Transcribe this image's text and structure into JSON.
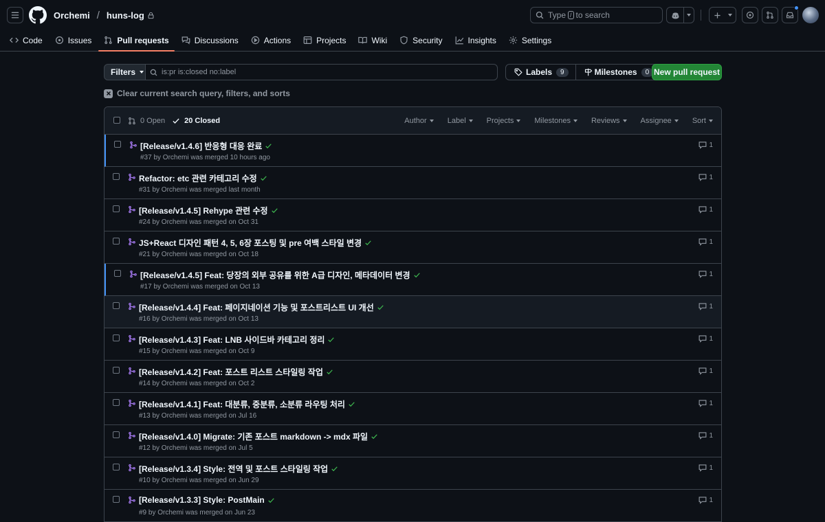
{
  "header": {
    "owner": "Orchemi",
    "separator": "/",
    "repo": "huns-log",
    "search_prefix": "Type",
    "search_key": "/",
    "search_suffix": "to search"
  },
  "repo_nav": [
    {
      "label": "Code",
      "icon": "code-icon",
      "active": false
    },
    {
      "label": "Issues",
      "icon": "issue-icon",
      "active": false
    },
    {
      "label": "Pull requests",
      "icon": "pull-request-icon",
      "active": true
    },
    {
      "label": "Discussions",
      "icon": "discussion-icon",
      "active": false
    },
    {
      "label": "Actions",
      "icon": "play-icon",
      "active": false
    },
    {
      "label": "Projects",
      "icon": "table-icon",
      "active": false
    },
    {
      "label": "Wiki",
      "icon": "book-icon",
      "active": false
    },
    {
      "label": "Security",
      "icon": "shield-icon",
      "active": false
    },
    {
      "label": "Insights",
      "icon": "graph-icon",
      "active": false
    },
    {
      "label": "Settings",
      "icon": "gear-icon",
      "active": false
    }
  ],
  "toolbar": {
    "filters_label": "Filters",
    "query": "is:pr is:closed no:label",
    "labels_label": "Labels",
    "labels_count": "9",
    "milestones_label": "Milestones",
    "milestones_count": "0",
    "new_pr_label": "New pull request",
    "clear_label": "Clear current search query, filters, and sorts"
  },
  "list_header": {
    "open_label": "0 Open",
    "closed_label": "20 Closed",
    "filters": [
      "Author",
      "Label",
      "Projects",
      "Milestones",
      "Reviews",
      "Assignee",
      "Sort"
    ]
  },
  "pull_requests": [
    {
      "title": "[Release/v1.4.6] 반응형 대응 완료",
      "meta": "#37 by Orchemi was merged 10 hours ago",
      "comments": "1",
      "unread": true,
      "hover": false
    },
    {
      "title": "Refactor: etc 관련 카테고리 수정",
      "meta": "#31 by Orchemi was merged last month",
      "comments": "1",
      "unread": false,
      "hover": false
    },
    {
      "title": "[Release/v1.4.5] Rehype 관련 수정",
      "meta": "#24 by Orchemi was merged on Oct 31",
      "comments": "1",
      "unread": false,
      "hover": false
    },
    {
      "title": "JS+React 디자인 패턴 4, 5, 6장 포스팅 및 pre 여백 스타일 변경",
      "meta": "#21 by Orchemi was merged on Oct 18",
      "comments": "1",
      "unread": false,
      "hover": false
    },
    {
      "title": "[Release/v1.4.5] Feat: 당장의 외부 공유를 위한 A급 디자인, 메타데이터 변경",
      "meta": "#17 by Orchemi was merged on Oct 13",
      "comments": "1",
      "unread": true,
      "hover": false
    },
    {
      "title": "[Release/v1.4.4] Feat: 페이지네이션 기능 및 포스트리스트 UI 개선",
      "meta": "#16 by Orchemi was merged on Oct 13",
      "comments": "1",
      "unread": false,
      "hover": true
    },
    {
      "title": "[Release/v1.4.3] Feat: LNB 사이드바 카테고리 정리",
      "meta": "#15 by Orchemi was merged on Oct 9",
      "comments": "1",
      "unread": false,
      "hover": false
    },
    {
      "title": "[Release/v1.4.2] Feat: 포스트 리스트 스타일링 작업",
      "meta": "#14 by Orchemi was merged on Oct 2",
      "comments": "1",
      "unread": false,
      "hover": false
    },
    {
      "title": "[Release/v1.4.1] Feat: 대분류, 중분류, 소분류 라우팅 처리",
      "meta": "#13 by Orchemi was merged on Jul 16",
      "comments": "1",
      "unread": false,
      "hover": false
    },
    {
      "title": "[Release/v1.4.0] Migrate: 기존 포스트 markdown -> mdx 파일",
      "meta": "#12 by Orchemi was merged on Jul 5",
      "comments": "1",
      "unread": false,
      "hover": false
    },
    {
      "title": "[Release/v1.3.4] Style: 전역 및 포스트 스타일링 작업",
      "meta": "#10 by Orchemi was merged on Jun 29",
      "comments": "1",
      "unread": false,
      "hover": false
    },
    {
      "title": "[Release/v1.3.3] Style: PostMain",
      "meta": "#9 by Orchemi was merged on Jun 23",
      "comments": "1",
      "unread": false,
      "hover": false
    }
  ],
  "colors": {
    "background": "#0d1117",
    "border": "#3d444d",
    "merged": "#ab7df8",
    "check": "#3fb950",
    "primary_button": "#238636",
    "active_tab": "#f78166"
  }
}
